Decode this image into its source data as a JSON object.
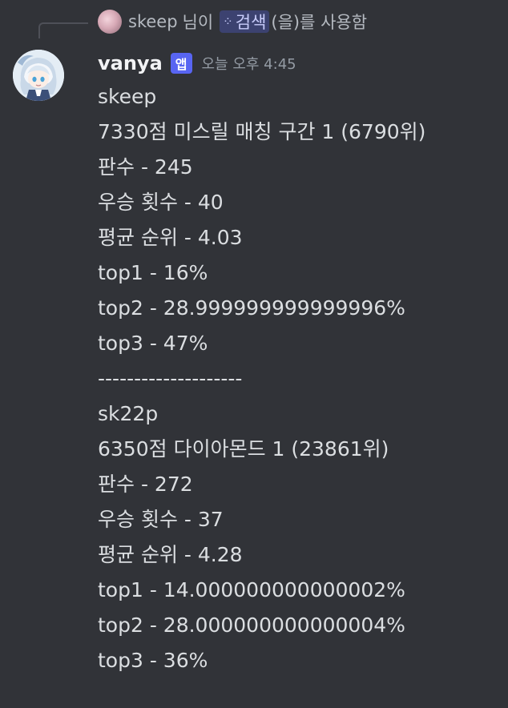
{
  "reply": {
    "username": "skeep",
    "mid_text": "님이",
    "command": "검색",
    "suffix": "(을)를 사용함"
  },
  "message": {
    "author": "vanya",
    "badge": "앱",
    "timestamp": "오늘 오후 4:45",
    "lines": [
      "skeep",
      "7330점 미스릴 매칭 구간 1 (6790위)",
      "판수 - 245",
      "우승 횟수 - 40",
      "평균 순위 - 4.03",
      "top1 - 16%",
      "top2 - 28.999999999999996%",
      "top3 - 47%",
      "--------------------",
      "sk22p",
      "6350점 다이아몬드 1 (23861위)",
      "판수 - 272",
      "우승 횟수 - 37",
      "평균 순위 - 4.28",
      "top1 - 14.000000000000002%",
      "top2 - 28.000000000000004%",
      "top3 - 36%"
    ]
  },
  "icons": {
    "command": "slash-command-icon"
  },
  "colors": {
    "background": "#313338",
    "badge": "#5865f2",
    "command_chip": "#3c4270"
  }
}
